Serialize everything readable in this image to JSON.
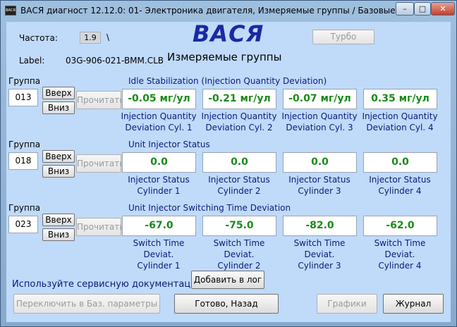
{
  "window": {
    "title": "ВАСЯ диагност 12.12.0: 01- Электроника двигателя,  Измеряемые группы / Базовые параметры",
    "icon_text": "ВАСЯ",
    "minimize": "–",
    "maximize": "□",
    "close": "✕"
  },
  "header": {
    "freq_label": "Частота:",
    "freq_value": "1.9",
    "freq_indicator": "\\",
    "label_caption": "Label:",
    "label_value": "03G-906-021-BMM.CLB",
    "brand": "ВАСЯ",
    "subtitle": "Измеряемые группы",
    "turbo": "Турбо"
  },
  "groups": [
    {
      "caption": "Группа",
      "number": "013",
      "up": "Вверх",
      "down": "Вниз",
      "read": "Прочитать",
      "title": "Idle Stabilization (Injection Quantity Deviation)",
      "cells": [
        {
          "value": "-0.05 мг/ул",
          "l1": "Injection Quantity",
          "l2": "Deviation Cyl. 1"
        },
        {
          "value": "-0.21 мг/ул",
          "l1": "Injection Quantity",
          "l2": "Deviation Cyl. 2"
        },
        {
          "value": "-0.07 мг/ул",
          "l1": "Injection Quantity",
          "l2": "Deviation Cyl. 3"
        },
        {
          "value": "0.35 мг/ул",
          "l1": "Injection Quantity",
          "l2": "Deviation Cyl. 4"
        }
      ]
    },
    {
      "caption": "Группа",
      "number": "018",
      "up": "Вверх",
      "down": "Вниз",
      "read": "Прочитать",
      "title": "Unit Injector Status",
      "cells": [
        {
          "value": "0.0",
          "l1": "Injector Status",
          "l2": "Cylinder 1"
        },
        {
          "value": "0.0",
          "l1": "Injector Status",
          "l2": "Cylinder 2"
        },
        {
          "value": "0.0",
          "l1": "Injector Status",
          "l2": "Cylinder 3"
        },
        {
          "value": "0.0",
          "l1": "Injector Status",
          "l2": "Cylinder 4"
        }
      ]
    },
    {
      "caption": "Группа",
      "number": "023",
      "up": "Вверх",
      "down": "Вниз",
      "read": "Прочитать",
      "title": "Unit Injector Switching Time Deviation",
      "cells": [
        {
          "value": "-67.0",
          "l1": "Switch Time Deviat.",
          "l2": "Cylinder 1"
        },
        {
          "value": "-75.0",
          "l1": "Switch Time Deviat.",
          "l2": "Cylinder 2"
        },
        {
          "value": "-82.0",
          "l1": "Switch Time Deviat.",
          "l2": "Cylinder 3"
        },
        {
          "value": "-62.0",
          "l1": "Switch Time Deviat.",
          "l2": "Cylinder 4"
        }
      ]
    }
  ],
  "footer": {
    "note": "Используйте сервисную документацию!",
    "add_log": "Добавить в лог",
    "switch_basic": "Переключить в Баз. параметры",
    "done_back": "Готово, Назад",
    "graphs": "Графики",
    "journal": "Журнал"
  }
}
